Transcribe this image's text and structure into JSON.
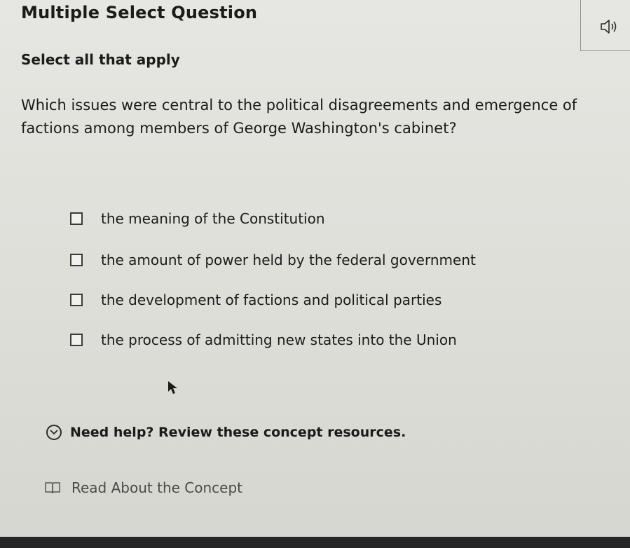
{
  "header": {
    "title": "Multiple Select Question",
    "audio_icon": "speaker-icon"
  },
  "instructions": "Select all that apply",
  "question": "Which issues were central to the political disagreements and emergence of factions among members of George Washington's cabinet?",
  "options": [
    {
      "label": "the meaning of the Constitution",
      "checked": false
    },
    {
      "label": "the amount of power held by the federal government",
      "checked": false
    },
    {
      "label": "the development of factions and political parties",
      "checked": false
    },
    {
      "label": "the process of admitting new states into the Union",
      "checked": false
    }
  ],
  "help": {
    "text": "Need help? Review these concept resources.",
    "icon": "chevron-down-circle-icon"
  },
  "resources": [
    {
      "label": "Read About the Concept",
      "icon": "book-icon"
    }
  ],
  "colors": {
    "text": "#1b1b1b",
    "background": "#e6e6e2",
    "muted_text": "#4a4a4a"
  }
}
